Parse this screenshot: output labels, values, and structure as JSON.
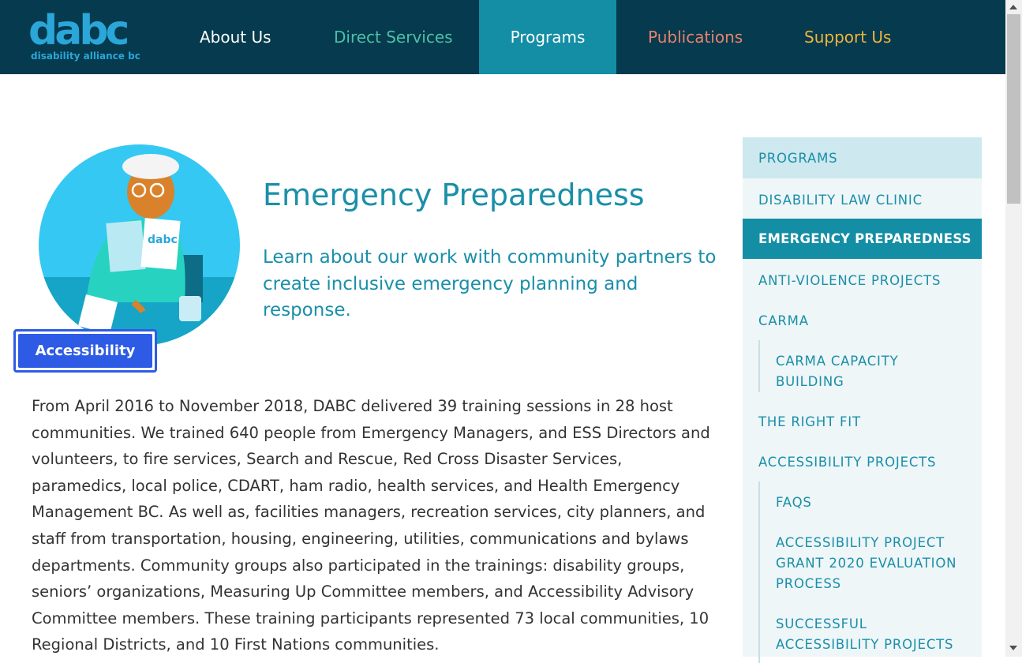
{
  "logo": {
    "wordmark": "dabc",
    "subtitle": "disability alliance bc"
  },
  "nav": [
    {
      "label": "About Us",
      "color": "#ffffff"
    },
    {
      "label": "Direct Services",
      "color": "#4cc1a6"
    },
    {
      "label": "Programs",
      "color": "#ffffff",
      "active": true
    },
    {
      "label": "Publications",
      "color": "#e8826e"
    },
    {
      "label": "Support Us",
      "color": "#f0b43c"
    }
  ],
  "hero": {
    "image_icon": "person-reading-dabc-booklet-illustration",
    "booklet_text": "dabc",
    "title": "Emergency Preparedness",
    "subtitle": "Learn about our work with community partners to create inclusive emergency planning and response."
  },
  "accessibility_button": {
    "label": "Accessibility"
  },
  "body": "From April 2016 to November 2018, DABC delivered 39 training sessions in 28 host communities. We trained 640 people from Emergency Managers, and ESS Directors and volunteers, to fire services, Search and Rescue, Red Cross Disaster Services, paramedics, local police, CDART, ham radio, health services, and Health Emergency Management BC. As well as, facilities managers, recreation services, city planners, and staff from transportation, housing, engineering, utilities, communications and bylaws departments. Community groups also participated in the trainings: disability groups, seniors’ organizations, Measuring Up Committee members, and Accessibility Advisory Committee members. These  training participants represented 73 local communities, 10 Regional Districts, and 10 First Nations communities.",
  "sidebar": {
    "heading": "PROGRAMS",
    "items": [
      "DISABILITY LAW CLINIC",
      "EMERGENCY PREPAREDNESS",
      "ANTI-VIOLENCE PROJECTS",
      "CARMA",
      "CARMA CAPACITY BUILDING",
      "THE RIGHT FIT",
      "ACCESSIBILITY PROJECTS",
      "FAQS",
      "ACCESSIBILITY PROJECT GRANT 2020 EVALUATION PROCESS",
      "SUCCESSFUL ACCESSIBILITY PROJECTS"
    ]
  },
  "colors": {
    "header_bg": "#063a4e",
    "accent": "#138ea5",
    "title": "#1a8fa8",
    "button": "#2e5be6"
  }
}
